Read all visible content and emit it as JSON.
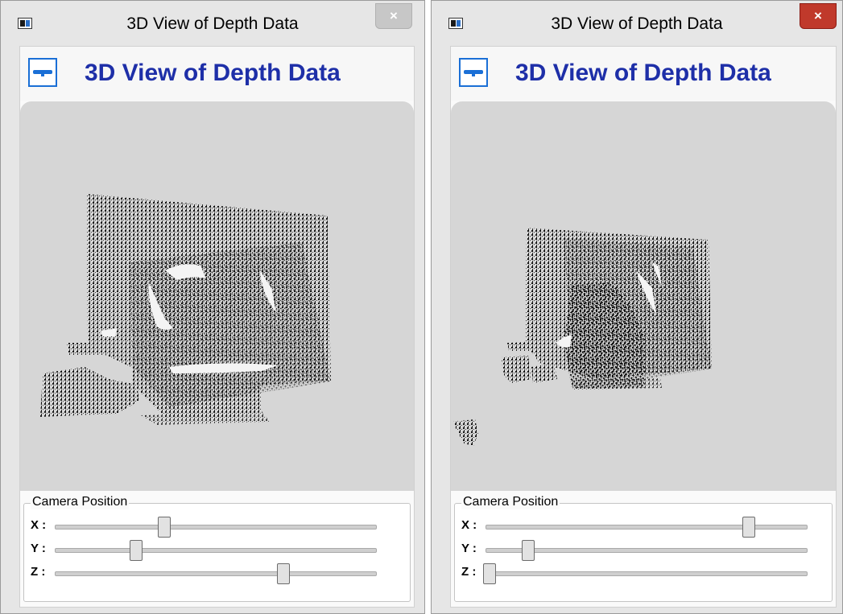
{
  "windows": [
    {
      "title": "3D View of Depth Data",
      "header_title": "3D View of Depth Data",
      "close_label": "×",
      "close_active": false,
      "camera_panel": {
        "legend": "Camera Position",
        "sliders": [
          {
            "label": "X :",
            "value": 0.34
          },
          {
            "label": "Y :",
            "value": 0.25
          },
          {
            "label": "Z :",
            "value": 0.71
          }
        ]
      }
    },
    {
      "title": "3D View of Depth Data",
      "header_title": "3D View of Depth Data",
      "close_label": "×",
      "close_active": true,
      "camera_panel": {
        "legend": "Camera Position",
        "sliders": [
          {
            "label": "X :",
            "value": 0.82
          },
          {
            "label": "Y :",
            "value": 0.13
          },
          {
            "label": "Z :",
            "value": 0.0
          }
        ]
      }
    }
  ],
  "colors": {
    "header_text": "#1e2fa8",
    "viewport_bg": "#d6d6d6",
    "close_active": "#c0392b",
    "close_inactive": "#c7c7c7"
  },
  "icons": {
    "app": "window-app-icon",
    "kinect": "kinect-sensor-icon",
    "close": "close-icon"
  }
}
